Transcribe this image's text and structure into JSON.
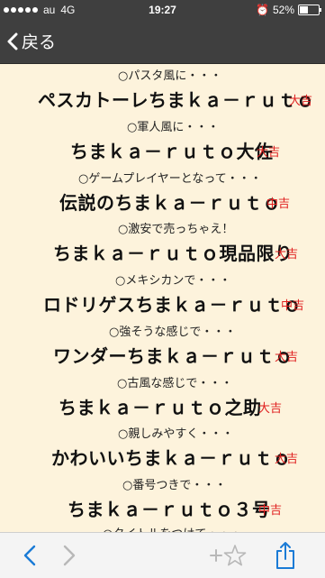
{
  "status": {
    "carrier": "au",
    "network": "4G",
    "time": "19:27",
    "battery": "52%",
    "battery_level": 0.52
  },
  "nav": {
    "back_label": "戻る"
  },
  "entries": [
    {
      "intro": "○パスタ風に・・・",
      "name": "ペスカトーレちまｋａ－ｒｕｔｏ",
      "rank": "大吉"
    },
    {
      "intro": "○軍人風に・・・",
      "name": "ちまｋａ－ｒｕｔｏ大佐",
      "rank": "大吉"
    },
    {
      "intro": "○ゲームプレイヤーとなって・・・",
      "name": "伝説のちまｋａ－ｒｕｔｏ",
      "rank": "中吉"
    },
    {
      "intro": "○激安で売っちゃえ！",
      "name": "ちまｋａ－ｒｕｔｏ現品限り",
      "rank": "大吉"
    },
    {
      "intro": "○メキシカンで・・・",
      "name": "ロドリゲスちまｋａ－ｒｕｔｏ",
      "rank": "中吉"
    },
    {
      "intro": "○強そうな感じで・・・",
      "name": "ワンダーちまｋａ－ｒｕｔｏ",
      "rank": "大吉"
    },
    {
      "intro": "○古風な感じで・・・",
      "name": "ちまｋａ－ｒｕｔｏ之助",
      "rank": "大吉"
    },
    {
      "intro": "○親しみやすく・・・",
      "name": "かわいいちまｋａ－ｒｕｔｏ",
      "rank": "大吉"
    },
    {
      "intro": "○番号つきで・・・",
      "name": "ちまｋａ－ｒｕｔｏ３号",
      "rank": "中吉"
    },
    {
      "intro": "○タイトルをつけて・・・",
      "name": "",
      "rank": ""
    }
  ]
}
